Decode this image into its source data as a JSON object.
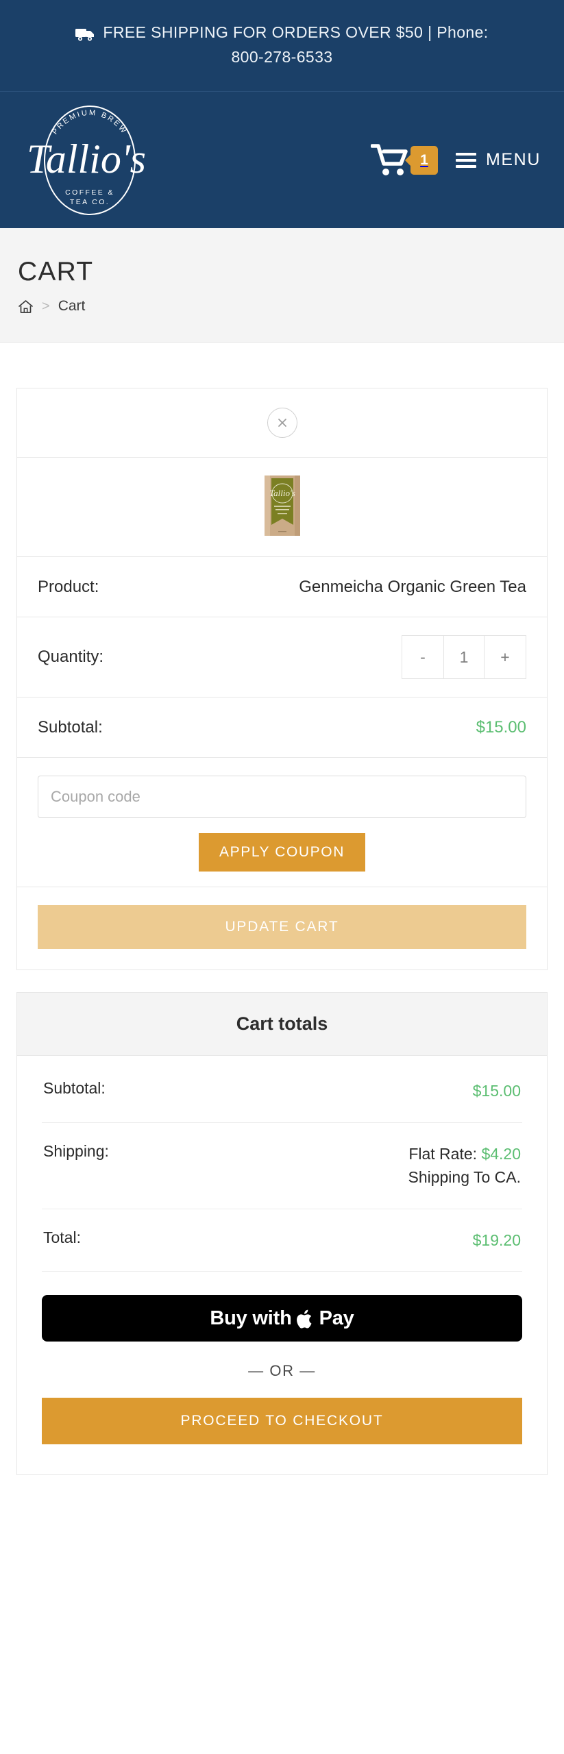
{
  "announcement": {
    "icon": "truck-icon",
    "line1": "FREE SHIPPING FOR ORDERS OVER $50 | Phone:",
    "line2": "800-278-6533"
  },
  "header": {
    "logo": {
      "top_arc": "PREMIUM BREW",
      "script": "Tallio's",
      "bottom_line1": "COFFEE &",
      "bottom_line2": "TEA CO."
    },
    "cart": {
      "icon": "shopping-cart-icon",
      "badge_count": "1"
    },
    "menu": {
      "icon": "hamburger-icon",
      "label": "MENU"
    }
  },
  "page": {
    "title": "CART",
    "breadcrumb": {
      "home_icon": "home-icon",
      "separator": ">",
      "current": "Cart"
    }
  },
  "cart_item": {
    "remove_icon": "close-x-icon",
    "remove_label": "Remove this item",
    "thumbnail_alt": "Genmeicha Organic Green Tea package",
    "product_label": "Product:",
    "product_name": "Genmeicha Organic Green Tea",
    "quantity_label": "Quantity:",
    "quantity_minus": "-",
    "quantity_value": "1",
    "quantity_plus": "+",
    "subtotal_label": "Subtotal:",
    "subtotal_value": "$15.00"
  },
  "coupon": {
    "placeholder": "Coupon code",
    "value": "",
    "apply_label": "APPLY COUPON"
  },
  "update_cart_label": "UPDATE CART",
  "cart_totals": {
    "heading": "Cart totals",
    "rows": [
      {
        "label": "Subtotal:",
        "value": "$15.00",
        "value_green": true
      },
      {
        "label": "Shipping:",
        "prefix": "Flat Rate: ",
        "value": "$4.20",
        "value_green": true,
        "sub": "Shipping To CA."
      },
      {
        "label": "Total:",
        "value": "$19.20",
        "value_green": true
      }
    ]
  },
  "checkout": {
    "apple_pay_prefix": "Buy with",
    "apple_pay_icon": "apple-logo-icon",
    "apple_pay_suffix": "Pay",
    "or_divider": "— OR —",
    "proceed_label": "PROCEED TO CHECKOUT"
  },
  "colors": {
    "navy": "#1b4068",
    "orange": "#dc9a30",
    "orange_light": "#edcb91",
    "green": "#5cbe72",
    "page_bg": "#ffffff",
    "section_bg": "#f4f4f4",
    "border": "#e7e7e7"
  }
}
